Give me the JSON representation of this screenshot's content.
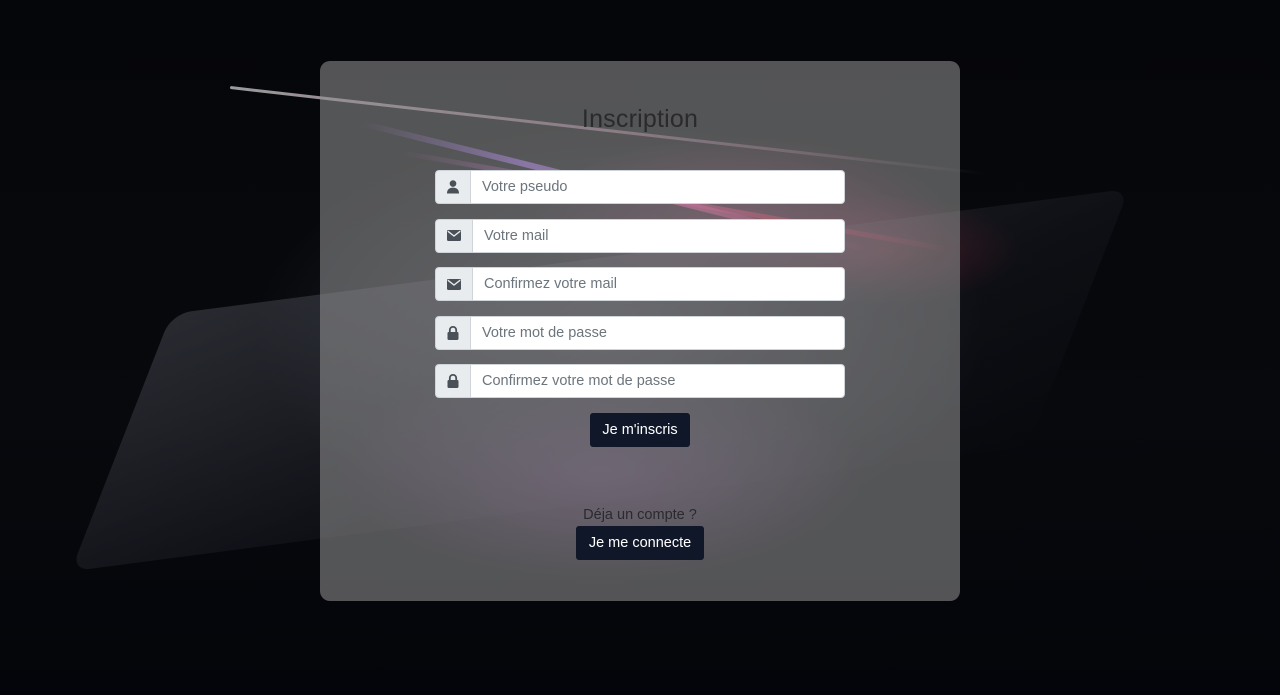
{
  "page": {
    "title": "Inscription"
  },
  "form": {
    "fields": [
      {
        "icon": "user-icon",
        "placeholder": "Votre pseudo",
        "type": "text"
      },
      {
        "icon": "envelope-icon",
        "placeholder": "Votre mail",
        "type": "email"
      },
      {
        "icon": "envelope-icon",
        "placeholder": "Confirmez votre mail",
        "type": "email"
      },
      {
        "icon": "lock-icon",
        "placeholder": "Votre mot de passe",
        "type": "password"
      },
      {
        "icon": "lock-icon",
        "placeholder": "Confirmez votre mot de passe",
        "type": "password"
      }
    ],
    "submit_label": "Je m'inscris"
  },
  "login": {
    "prompt": "Déja un compte ?",
    "button_label": "Je me connecte"
  },
  "colors": {
    "button_bg": "#0f1728",
    "card_bg": "rgba(150,150,150,0.55)",
    "addon_bg": "#e9ecef"
  }
}
